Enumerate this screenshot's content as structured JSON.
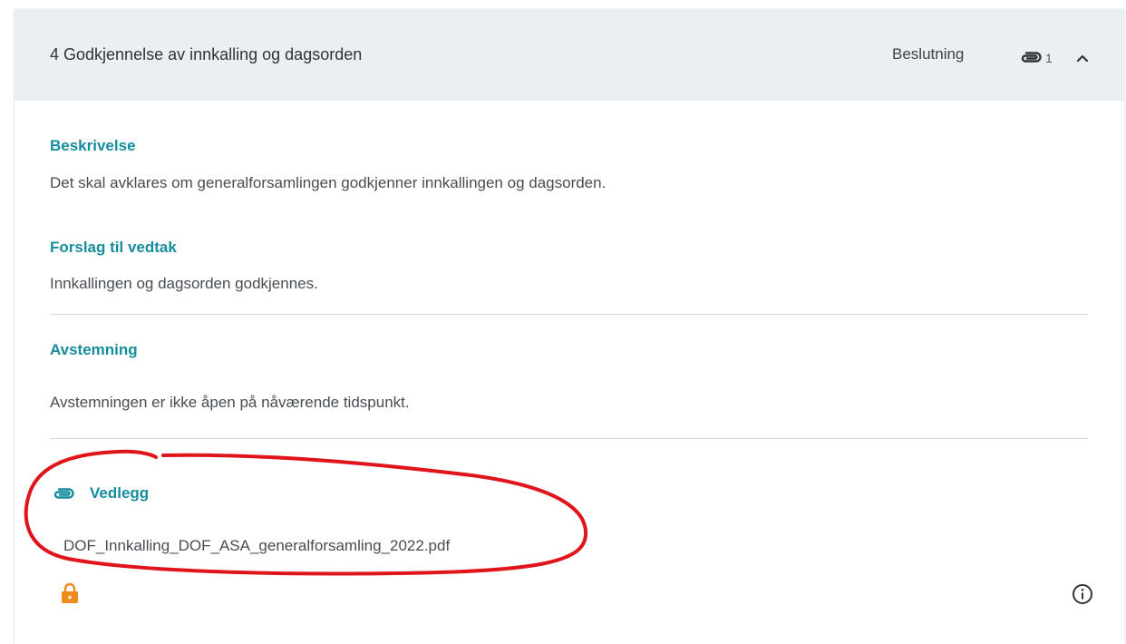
{
  "agenda_item": {
    "title": "4 Godkjennelse av innkalling og dagsorden",
    "type": "Beslutning",
    "attachment_count": "1"
  },
  "description": {
    "heading": "Beskrivelse",
    "text": "Det skal avklares om generalforsamlingen godkjenner innkallingen og dagsorden."
  },
  "proposal": {
    "heading": "Forslag til vedtak",
    "text": "Innkallingen og dagsorden godkjennes."
  },
  "voting": {
    "heading": "Avstemning",
    "text": "Avstemningen er ikke åpen på nåværende tidspunkt."
  },
  "attachments": {
    "heading": "Vedlegg",
    "files": [
      "DOF_Innkalling_DOF_ASA_generalforsamling_2022.pdf"
    ]
  },
  "icons": {
    "attachment": "paperclip-icon",
    "collapse": "chevron-up-icon",
    "lock": "lock-icon",
    "info": "info-icon"
  },
  "colors": {
    "accent": "#168d9c",
    "lock": "#f08a1c",
    "annotation": "#e0141b",
    "header_bg": "#eceff2"
  }
}
